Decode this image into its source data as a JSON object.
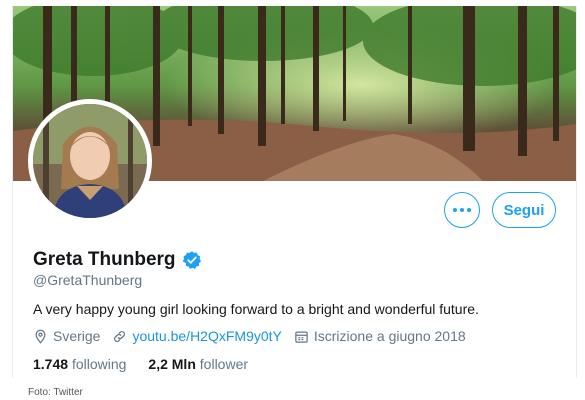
{
  "profile": {
    "name": "Greta Thunberg",
    "handle": "@GretaThunberg",
    "bio": "A very happy young girl looking forward to a bright and wonderful future.",
    "location": "Sverige",
    "website": "youtu.be/H2QxFM9y0tY",
    "joined": "Iscrizione a giugno 2018",
    "following_count": "1.748",
    "following_label": "following",
    "followers_count": "2,2 Mln",
    "followers_label": "follower",
    "verified": true
  },
  "actions": {
    "follow_label": "Segui",
    "more_icon": "more-dots-icon"
  },
  "icons": {
    "location": "location-pin-icon",
    "link": "link-icon",
    "calendar": "calendar-icon",
    "verified": "verified-badge-icon"
  },
  "colors": {
    "accent": "#1da1f2",
    "link": "#1b95e0",
    "secondary_text": "#657786",
    "primary_text": "#14171a"
  },
  "caption": "Foto: Twitter"
}
